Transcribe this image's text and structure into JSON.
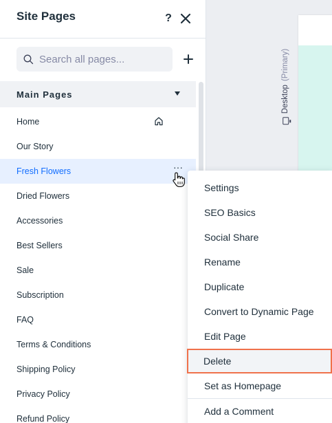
{
  "panel": {
    "title": "Site Pages",
    "help_label": "?",
    "search_placeholder": "Search all pages...",
    "section_label": "Main Pages"
  },
  "canvas": {
    "device_label": "Desktop",
    "device_sub": "(Primary)"
  },
  "pages": [
    {
      "label": "Home",
      "home": true
    },
    {
      "label": "Our Story"
    },
    {
      "label": "Fresh Flowers",
      "selected": true
    },
    {
      "label": "Dried Flowers"
    },
    {
      "label": "Accessories"
    },
    {
      "label": "Best Sellers"
    },
    {
      "label": "Sale"
    },
    {
      "label": "Subscription"
    },
    {
      "label": "FAQ"
    },
    {
      "label": "Terms & Conditions"
    },
    {
      "label": "Shipping Policy"
    },
    {
      "label": "Privacy Policy"
    },
    {
      "label": "Refund Policy"
    }
  ],
  "context_menu": {
    "items": [
      "Settings",
      "SEO Basics",
      "Social Share",
      "Rename",
      "Duplicate",
      "Convert to Dynamic Page",
      "Edit Page",
      "Delete",
      "Set as Homepage",
      "Add a Comment"
    ],
    "highlighted": "Delete"
  },
  "colors": {
    "accent": "#116dff",
    "selected_bg": "#e7f0ff",
    "highlight_border": "#f0714a",
    "canvas_page": "#d7f5ef"
  },
  "icons": {
    "search": "search-icon",
    "close": "close-icon",
    "add": "plus-icon",
    "caret": "caret-down-icon",
    "home": "home-icon",
    "more": "more-dots-icon",
    "desktop": "desktop-icon",
    "cursor": "hand-cursor-icon"
  }
}
